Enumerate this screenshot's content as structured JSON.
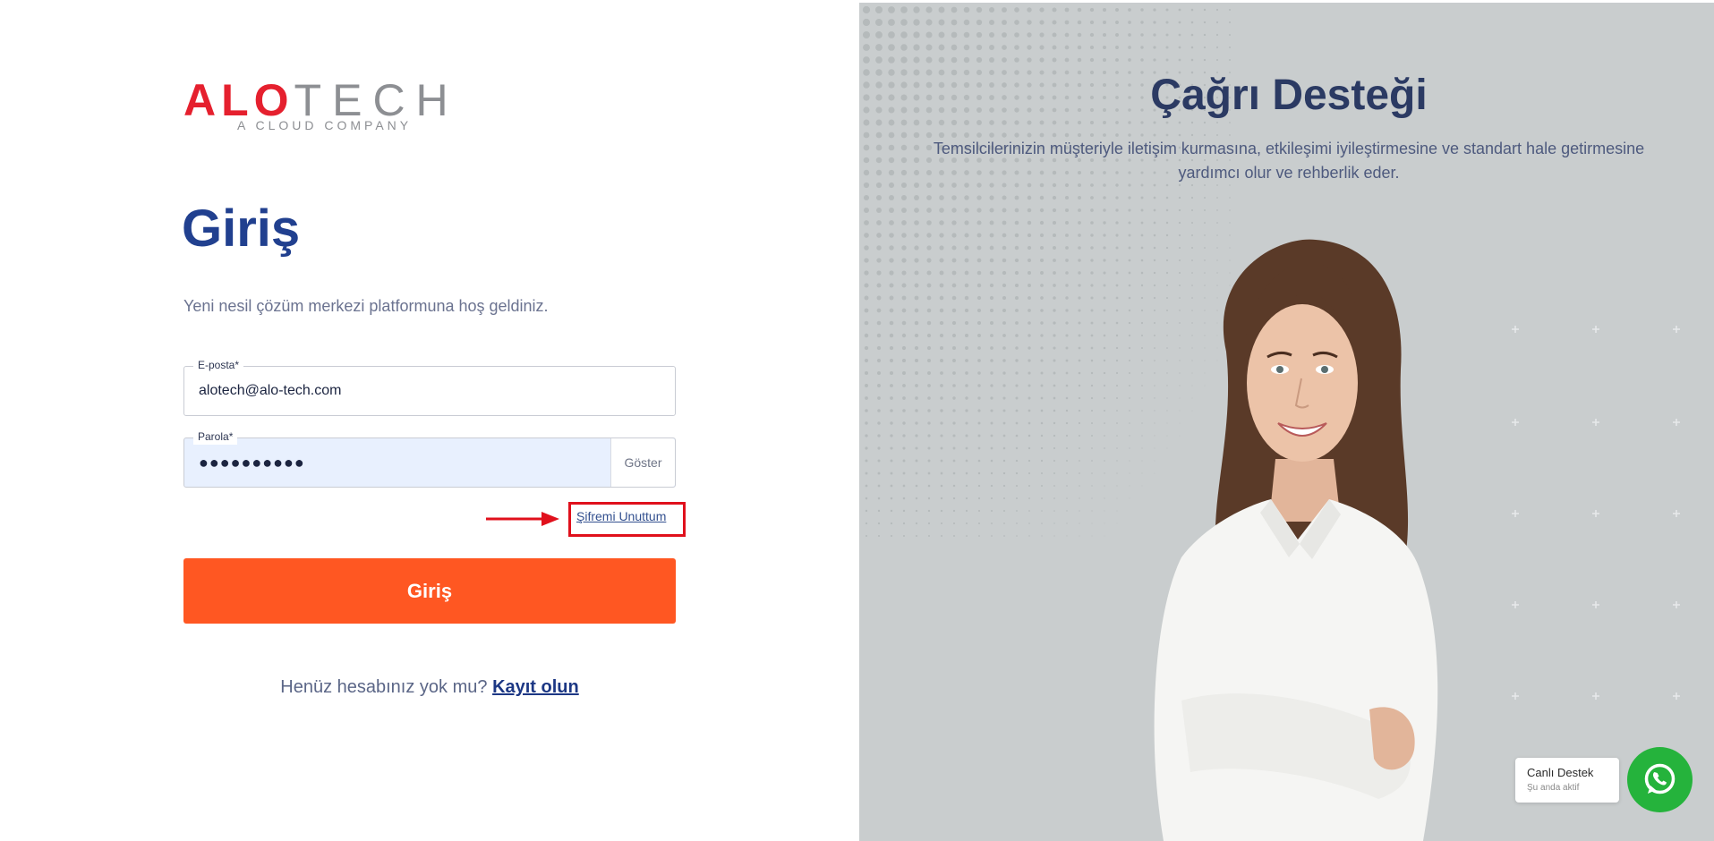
{
  "brand": {
    "logo_alo": "ALO",
    "logo_tech": "TECH",
    "logo_tagline": "A CLOUD COMPANY",
    "colors": {
      "red": "#e5202e",
      "gray": "#8d8f93",
      "primary": "#21408f",
      "accent": "#ff5722"
    }
  },
  "login": {
    "title": "Giriş",
    "welcome": "Yeni nesil çözüm merkezi platformuna hoş geldiniz.",
    "email": {
      "label": "E-posta*",
      "value": "alotech@alo-tech.com"
    },
    "password": {
      "label": "Parola*",
      "value": "●●●●●●●●●●",
      "show_label": "Göster"
    },
    "forgot_label": "Şifremi Unuttum",
    "submit_label": "Giriş",
    "signup_prompt": "Henüz hesabınız yok mu?",
    "signup_link": "Kayıt olun"
  },
  "promo": {
    "title": "Çağrı Desteği",
    "description": "Temsilcilerinizin müşteriyle iletişim kurmasına, etkileşimi iyileştirmesine ve standart hale getirmesine yardımcı olur ve rehberlik eder."
  },
  "support": {
    "title": "Canlı Destek",
    "status": "Şu anda aktif",
    "icon": "whatsapp-icon"
  }
}
